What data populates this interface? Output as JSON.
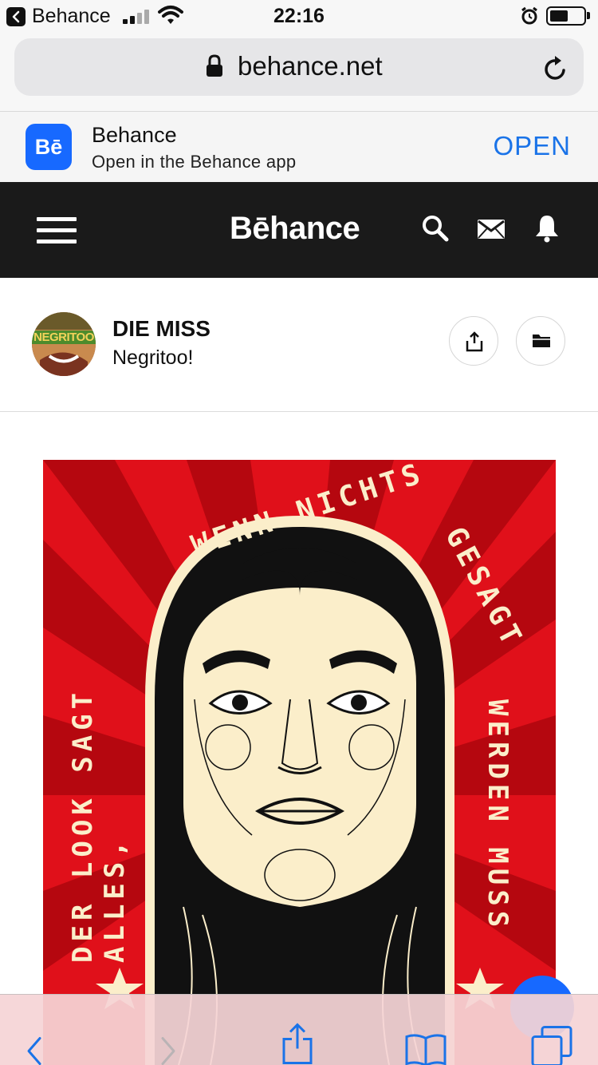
{
  "status_bar": {
    "back_app": "Behance",
    "time": "22:16"
  },
  "url_bar": {
    "url": "behance.net"
  },
  "app_banner": {
    "title": "Behance",
    "subtitle": "Open in the Behance app",
    "icon_text": "Bē",
    "open_label": "OPEN"
  },
  "site_header": {
    "brand": "Bēhance"
  },
  "project": {
    "title": "DIE MISS",
    "owner": "Negritoo!",
    "avatar_text": "NEGRITOO"
  },
  "artwork": {
    "arc_text": "WENN NICHTS GESAGT WERDEN MUSS",
    "left_text": "DER LOOK SAGT ALLES,",
    "right_text": "WERDEN MUSS",
    "top_left_text": "WENN NICHTS",
    "top_right_text": "GESAGT"
  },
  "colors": {
    "accent_blue": "#1769ff",
    "header_dark": "#1a1a1a",
    "artwork_red": "#e0101a",
    "artwork_cream": "#fbeeca",
    "ios_blue": "#1a73e8"
  },
  "icons": {
    "status": [
      "back-arrow-icon",
      "signal-icon",
      "wifi-icon",
      "alarm-icon",
      "battery-icon"
    ],
    "url_bar": [
      "lock-icon",
      "reload-icon"
    ],
    "header": [
      "menu-icon",
      "search-icon",
      "mail-icon",
      "bell-icon"
    ],
    "project": [
      "share-icon",
      "folder-icon"
    ],
    "toolbar": [
      "back-icon",
      "forward-icon",
      "share-icon",
      "bookmarks-icon",
      "tabs-icon"
    ]
  }
}
